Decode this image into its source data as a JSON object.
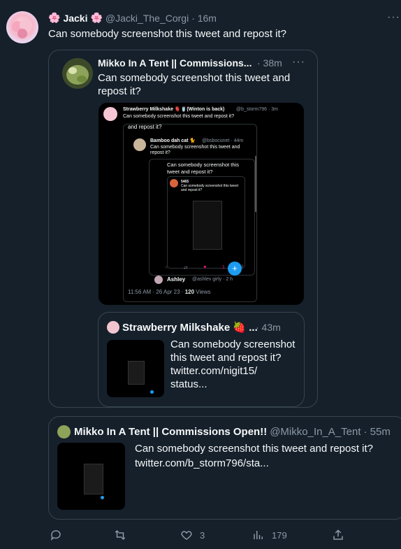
{
  "tweet": {
    "display_name": "Jacki",
    "handle": "@Jacki_The_Corgi",
    "time": "· 16m",
    "text": "Can somebody screenshot this tweet and repost it?"
  },
  "quote1": {
    "display_name": "Mikko In A Tent || Commissions...",
    "time": "· 38m",
    "text": "Can somebody screenshot this tweet and repost it?"
  },
  "screenshot": {
    "header_name": "Strawberry Milkshake 🫀🥤(Winton is back)",
    "header_handle": "@b_storm796 · 3m",
    "header_text": "Can somebody screenshot this tweet and repost it?",
    "partial_text": "and repost it?",
    "inner1_name": "Bamboo dah cat 🐈",
    "inner1_handle": "@bsbocunet · 44m",
    "inner1_text": "Can somebody screenshot this tweet and repost it?",
    "inner2_text": "Can somebody screenshot this tweet and repost it?",
    "inner3_name": "5465",
    "inner3_text": "Can somebody screenshot this tweet and repost it?",
    "like_count": "1",
    "reply_name": "Ashley",
    "reply_handle": "@ashlev girly · 2 h",
    "footer_time": "11:56 AM · 26 Apr 23 ·",
    "footer_views": "120",
    "footer_views_label": "Views"
  },
  "quote2": {
    "display_name": "Strawberry Milkshake 🍓 ...",
    "time": "· 43m",
    "text_lines": [
      "Can somebody screenshot",
      "this tweet and repost it?",
      "twitter.com/nigit15/",
      "status..."
    ]
  },
  "quote3": {
    "display_name": "Mikko In A Tent || Commissions Open!!",
    "handle": "@Mikko_In_A_Tent",
    "time": "· 55m",
    "text": "Can somebody screenshot this tweet and repost it?",
    "link": "twitter.com/b_storm796/sta..."
  },
  "actions": {
    "reply_count": "",
    "retweet_count": "",
    "like_count": "3",
    "views_count": "179"
  },
  "more_label": "···",
  "colors": {
    "background": "#15202b",
    "border": "#38444d",
    "muted": "#8b98a5",
    "accent": "#1d9bf0",
    "like": "#f91880"
  }
}
